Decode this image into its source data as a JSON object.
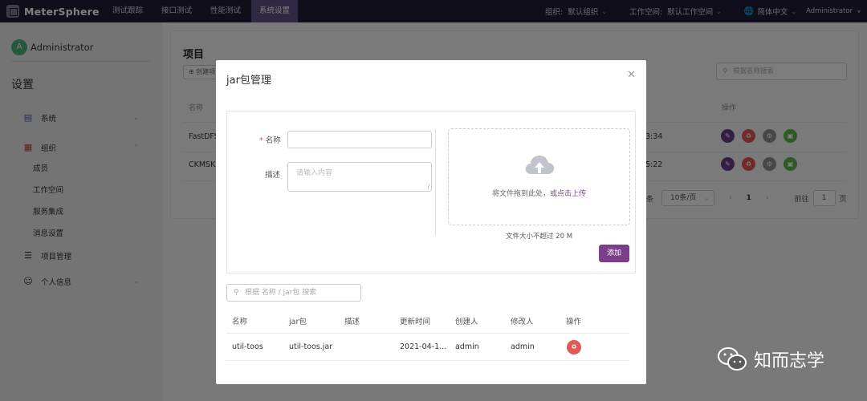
{
  "topbar": {
    "logo": "MeterSphere",
    "tabs": [
      "测试跟踪",
      "接口测试",
      "性能测试",
      "系统设置"
    ],
    "active_tab": "系统设置",
    "org_label": "组织:",
    "org_value": "默认组织",
    "workspace_label": "工作空间:",
    "workspace_value": "默认工作空间",
    "language": "简体中文",
    "user": "Administrator"
  },
  "sidebar": {
    "avatar_letter": "A",
    "user_name": "Administrator",
    "title": "设置",
    "menu": {
      "system": "系统",
      "org": "组织",
      "org_children": [
        "成员",
        "工作空间",
        "服务集成",
        "消息设置"
      ],
      "project": "项目管理",
      "personal": "个人信息"
    }
  },
  "main": {
    "title": "项目",
    "create_label": "创建项",
    "search_placeholder": "根据名称搜索",
    "col_name": "名称",
    "col_op": "操作",
    "rows": [
      {
        "name": "FastDFS",
        "time": "3:34"
      },
      {
        "name": "CKMSK",
        "time": "5:22"
      }
    ],
    "pager": {
      "unit": "条",
      "page_size": "10条/页",
      "current": "1",
      "goto_label": "前往",
      "goto_value": "1",
      "page_label": "页"
    }
  },
  "dialog": {
    "title": "jar包管理",
    "form": {
      "name_label": "名称",
      "name_value": "",
      "desc_label": "描述",
      "desc_placeholder": "请输入内容"
    },
    "upload": {
      "text": "将文件拖到此处，或",
      "link": "点击上传",
      "tip": "文件大小不超过 20 M"
    },
    "add_button": "添加",
    "search_placeholder": "根据 名称 / jar包 搜索",
    "table": {
      "headers": [
        "名称",
        "jar包",
        "描述",
        "更新时间",
        "创建人",
        "修改人",
        "操作"
      ],
      "rows": [
        {
          "name": "util-toos",
          "jar": "util-toos.jar",
          "desc": "",
          "updated": "2021-04-1...",
          "creator": "admin",
          "modifier": "admin"
        }
      ]
    }
  },
  "watermark": "知而志学",
  "colors": {
    "topbar": "#1f1d34",
    "active_tab": "#5e5085",
    "primary": "#7b3f8a",
    "danger": "#e05959",
    "success": "#5ab54a",
    "avatar": "#4bb07a"
  }
}
